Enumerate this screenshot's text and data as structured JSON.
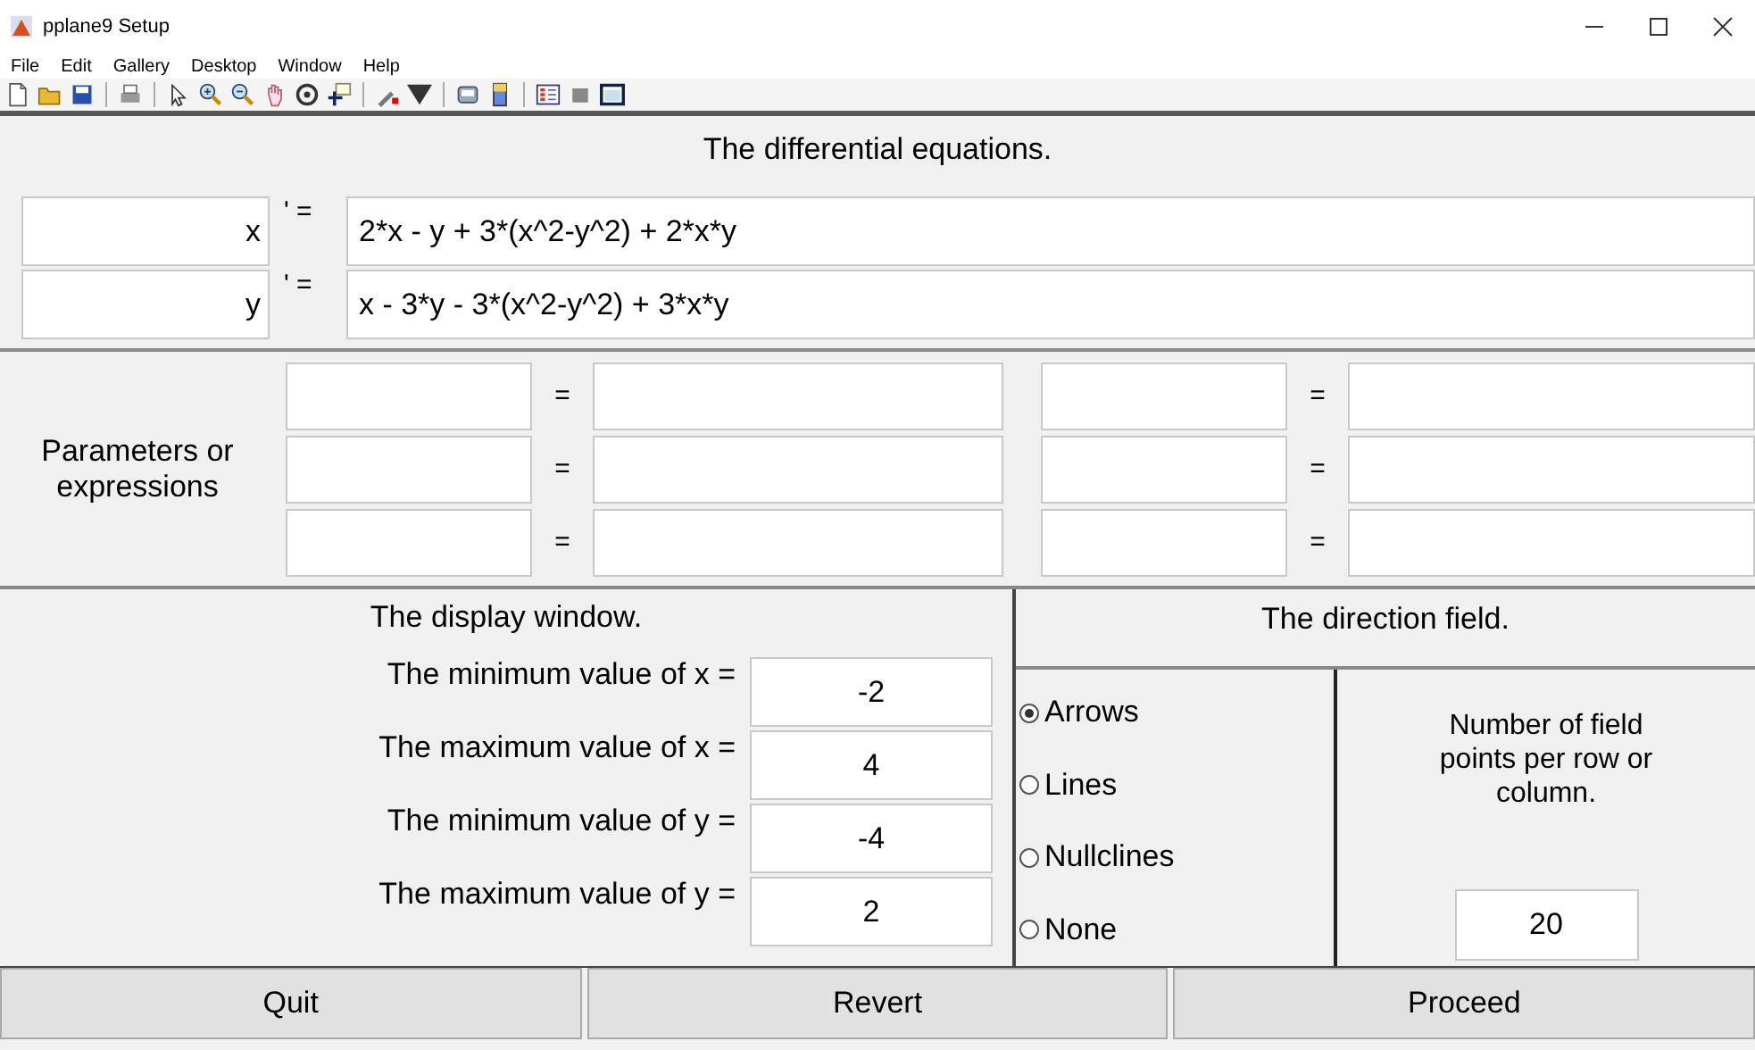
{
  "window": {
    "title": "pplane9 Setup"
  },
  "menu": [
    "File",
    "Edit",
    "Gallery",
    "Desktop",
    "Window",
    "Help"
  ],
  "equations": {
    "heading": "The differential equations.",
    "rows": [
      {
        "variable": "x",
        "prime": "' =",
        "expression": "2*x - y + 3*(x^2-y^2) + 2*x*y"
      },
      {
        "variable": "y",
        "prime": "' =",
        "expression": "x - 3*y - 3*(x^2-y^2) + 3*x*y"
      }
    ]
  },
  "parameters": {
    "label": "Parameters or expressions",
    "rows": [
      {
        "left_eq": "=",
        "right_eq": "="
      },
      {
        "left_eq": "=",
        "right_eq": "="
      },
      {
        "left_eq": "=",
        "right_eq": "="
      }
    ]
  },
  "display_window": {
    "heading": "The display window.",
    "rows": [
      {
        "label": "The minimum value of x =",
        "value": "-2"
      },
      {
        "label": "The maximum value of x =",
        "value": "4"
      },
      {
        "label": "The minimum value of y =",
        "value": "-4"
      },
      {
        "label": "The maximum value of y =",
        "value": "2"
      }
    ]
  },
  "direction_field": {
    "heading": "The direction field.",
    "options": [
      {
        "label": "Arrows",
        "selected": true
      },
      {
        "label": "Lines",
        "selected": false
      },
      {
        "label": "Nullclines",
        "selected": false
      },
      {
        "label": "None",
        "selected": false
      }
    ],
    "points_label": "Number of field points per row or column.",
    "points_value": "20"
  },
  "buttons": [
    "Quit",
    "Revert",
    "Proceed"
  ]
}
